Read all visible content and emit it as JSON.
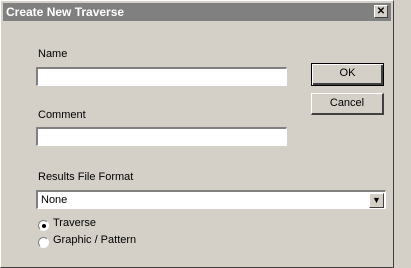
{
  "window": {
    "title": "Create New Traverse",
    "close_glyph": "✕",
    "close_icon": "close-icon"
  },
  "form": {
    "name_label": "Name",
    "name_value": "",
    "comment_label": "Comment",
    "comment_value": "",
    "results_label": "Results File Format",
    "results_value": "None",
    "dropdown_icon": "chevron-down-icon",
    "dropdown_glyph": "▼"
  },
  "buttons": {
    "ok": "OK",
    "cancel": "Cancel"
  },
  "options": {
    "traverse": "Traverse",
    "graphic": "Graphic / Pattern",
    "selected": "traverse"
  }
}
